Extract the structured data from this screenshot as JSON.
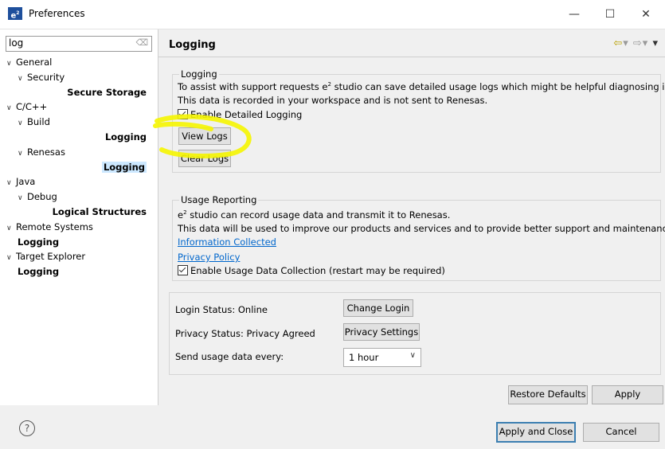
{
  "window": {
    "icon_text": "e",
    "icon_sup": "2",
    "title": "Preferences",
    "minimize": "—",
    "maximize": "☐",
    "close": "✕"
  },
  "filter": {
    "value": "log",
    "clear_icon": "⌫"
  },
  "tree": [
    {
      "label": "General",
      "level": 0,
      "expanded": true,
      "bold": false
    },
    {
      "label": "Security",
      "level": 1,
      "expanded": true,
      "bold": false
    },
    {
      "label": "Secure Storage",
      "level": 2,
      "bold": true
    },
    {
      "label": "C/C++",
      "level": 0,
      "expanded": true,
      "bold": false
    },
    {
      "label": "Build",
      "level": 1,
      "expanded": true,
      "bold": false
    },
    {
      "label": "Logging",
      "level": 2,
      "bold": true
    },
    {
      "label": "Renesas",
      "level": 1,
      "expanded": true,
      "bold": false
    },
    {
      "label": "Logging",
      "level": 2,
      "bold": true,
      "selected": true
    },
    {
      "label": "Java",
      "level": 0,
      "expanded": true,
      "bold": false
    },
    {
      "label": "Debug",
      "level": 1,
      "expanded": true,
      "bold": false
    },
    {
      "label": "Logical Structures",
      "level": 2,
      "bold": true
    },
    {
      "label": "Remote Systems",
      "level": 0,
      "expanded": true,
      "bold": false
    },
    {
      "label": "Logging",
      "level": 1,
      "bold": true
    },
    {
      "label": "Target Explorer",
      "level": 0,
      "expanded": true,
      "bold": false
    },
    {
      "label": "Logging",
      "level": 1,
      "bold": true
    }
  ],
  "page": {
    "title": "Logging",
    "nav": {
      "back": "⇦",
      "back_menu": "▾",
      "forward": "⇨",
      "forward_menu": "▾",
      "view_menu": "▾"
    }
  },
  "logging_group": {
    "legend": "Logging",
    "desc_pre": "To assist with support requests e",
    "desc_sup": "2",
    "desc_post": " studio can save detailed usage logs which might be helpful diagnosing issues.",
    "desc_line2": "This data is recorded in your workspace and is not sent to Renesas.",
    "enable_label": "Enable Detailed Logging",
    "enable_checked": true,
    "view_logs": "View Logs",
    "clear_logs": "Clear Logs"
  },
  "usage_group": {
    "legend": "Usage Reporting",
    "line1_pre": "e",
    "line1_sup": "2",
    "line1_post": " studio can record usage data and transmit it to Renesas.",
    "line2": "This data will be used to improve our products and services and to provide better support and maintenance.",
    "info_link": "Information Collected",
    "privacy_link": "Privacy Policy",
    "enable_label": "Enable Usage Data Collection (restart may be required)",
    "enable_checked": true
  },
  "account": {
    "login_status": "Login Status:  Online",
    "change_login": "Change Login",
    "privacy_status": "Privacy Status: Privacy Agreed",
    "privacy_settings": "Privacy Settings",
    "send_label": "Send usage data every:",
    "send_value": "1 hour",
    "send_arrow": "∨"
  },
  "buttons": {
    "restore_defaults": "Restore Defaults",
    "apply": "Apply",
    "apply_close": "Apply and Close",
    "cancel": "Cancel",
    "help": "?"
  },
  "colors": {
    "selection": "#cce8ff",
    "link": "#0066cc",
    "highlight": "#f5f500"
  }
}
